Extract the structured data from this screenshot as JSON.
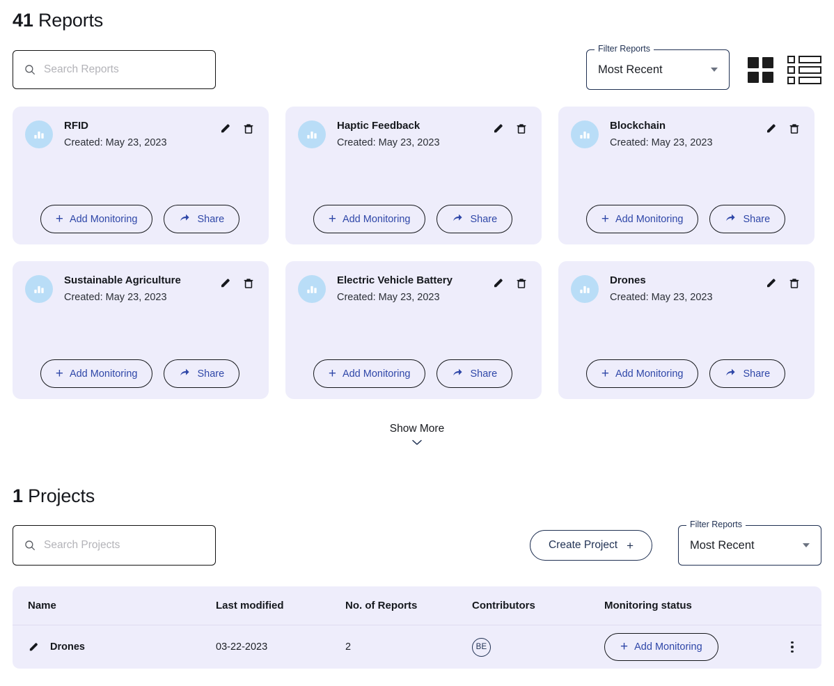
{
  "reports_section": {
    "count": "41",
    "title": "Reports",
    "search": {
      "placeholder": "Search Reports",
      "value": "",
      "icon": "search-icon"
    },
    "filter": {
      "legend": "Filter Reports",
      "value": "Most Recent",
      "options": [
        "Most Recent"
      ],
      "icon": "chevron-down-icon"
    },
    "view_toggles": [
      {
        "name": "grid-view-icon",
        "active": true
      },
      {
        "name": "list-view-icon",
        "active": false
      }
    ],
    "card_actions": {
      "edit_icon": "pencil-icon",
      "delete_icon": "trash-icon",
      "add_monitoring_label": "Add Monitoring",
      "add_monitoring_icon": "plus-icon",
      "share_label": "Share",
      "share_icon": "share-arrow-icon",
      "avatar_icon": "bar-chart-icon"
    },
    "cards": [
      {
        "title": "RFID",
        "created": "Created: May 23, 2023"
      },
      {
        "title": "Haptic Feedback",
        "created": "Created: May 23, 2023"
      },
      {
        "title": "Blockchain",
        "created": "Created: May 23, 2023"
      },
      {
        "title": "Sustainable Agriculture",
        "created": "Created: May 23, 2023"
      },
      {
        "title": "Electric Vehicle Battery",
        "created": "Created: May 23, 2023"
      },
      {
        "title": "Drones",
        "created": "Created: May 23, 2023"
      }
    ],
    "show_more": {
      "label": "Show More",
      "icon": "chevron-down-icon"
    }
  },
  "projects_section": {
    "count": "1",
    "title": "Projects",
    "search": {
      "placeholder": "Search Projects",
      "value": "",
      "icon": "search-icon"
    },
    "create_button": {
      "label": "Create Project",
      "icon": "plus-icon"
    },
    "filter": {
      "legend": "Filter Reports",
      "value": "Most Recent",
      "options": [
        "Most Recent"
      ],
      "icon": "chevron-down-icon"
    },
    "table": {
      "columns": [
        "Name",
        "Last modified",
        "No. of Reports",
        "Contributors",
        "Monitoring status"
      ],
      "rows": [
        {
          "name": "Drones",
          "name_icon": "pencil-icon",
          "last_modified": "03-22-2023",
          "no_of_reports": "2",
          "contributor_initials": "BE",
          "monitoring_label": "Add Monitoring",
          "monitoring_icon": "plus-icon",
          "menu_icon": "kebab-menu-icon"
        }
      ]
    }
  },
  "colors": {
    "card_background": "#eeedfb",
    "avatar_blue": "#b9ddf7",
    "accent_blue": "#2f47a8",
    "navy": "#1f3052",
    "text_dark": "#15181d"
  }
}
